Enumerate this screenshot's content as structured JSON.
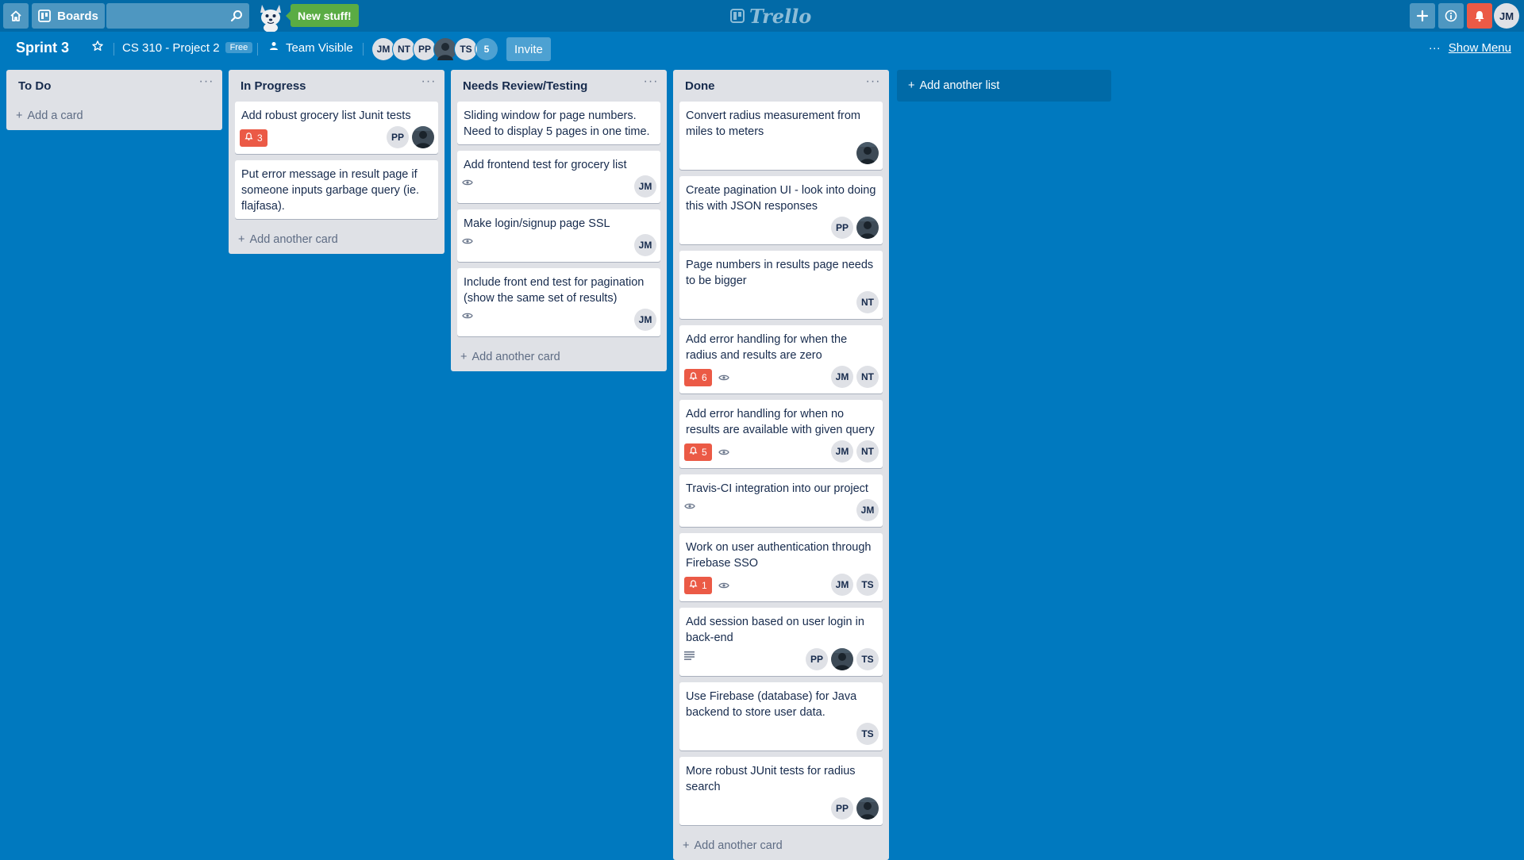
{
  "header": {
    "boards_label": "Boards",
    "search_value": "",
    "new_stuff_label": "New stuff!",
    "logo_text": "Trello",
    "user_initials": "JM"
  },
  "board": {
    "title": "Sprint 3",
    "team_name": "CS 310 - Project 2",
    "plan_badge": "Free",
    "visibility_label": "Team Visible",
    "members": [
      "JM",
      "NT",
      "PP",
      "",
      "TS"
    ],
    "extra_members_count": "5",
    "invite_label": "Invite",
    "show_menu_label": "Show Menu",
    "add_list_label": "Add another list"
  },
  "colors": {
    "background": "#0079bf",
    "topbar": "#026aa7",
    "due_badge": "#eb5a46",
    "new_stuff": "#5aac44",
    "list": "#dfe1e6"
  },
  "lists": [
    {
      "title": "To Do",
      "add_label": "Add a card",
      "cards": []
    },
    {
      "title": "In Progress",
      "add_label": "Add another card",
      "cards": [
        {
          "title": "Add robust grocery list Junit tests",
          "due": "3",
          "watch": false,
          "desc": false,
          "members": [
            "PP",
            "photo"
          ]
        },
        {
          "title": "Put error message in result page if someone inputs garbage query (ie. flajfasa).",
          "due": null,
          "watch": false,
          "desc": false,
          "members": []
        }
      ]
    },
    {
      "title": "Needs Review/Testing",
      "add_label": "Add another card",
      "cards": [
        {
          "title": "Sliding window for page numbers. Need to display 5 pages in one time.",
          "due": null,
          "watch": false,
          "desc": false,
          "members": []
        },
        {
          "title": "Add frontend test for grocery list",
          "due": null,
          "watch": true,
          "desc": false,
          "members": [
            "JM"
          ]
        },
        {
          "title": "Make login/signup page SSL",
          "due": null,
          "watch": true,
          "desc": false,
          "members": [
            "JM"
          ]
        },
        {
          "title": "Include front end test for pagination (show the same set of results)",
          "due": null,
          "watch": true,
          "desc": false,
          "members": [
            "JM"
          ]
        }
      ]
    },
    {
      "title": "Done",
      "add_label": "Add another card",
      "cards": [
        {
          "title": "Convert radius measurement from miles to meters",
          "due": null,
          "watch": false,
          "desc": false,
          "members": [
            "photo"
          ]
        },
        {
          "title": "Create pagination UI - look into doing this with JSON responses",
          "due": null,
          "watch": false,
          "desc": false,
          "members": [
            "PP",
            "photo"
          ]
        },
        {
          "title": "Page numbers in results page needs to be bigger",
          "due": null,
          "watch": false,
          "desc": false,
          "members": [
            "NT"
          ]
        },
        {
          "title": "Add error handling for when the radius and results are zero",
          "due": "6",
          "watch": true,
          "desc": false,
          "members": [
            "JM",
            "NT"
          ]
        },
        {
          "title": "Add error handling for when no results are available with given query",
          "due": "5",
          "watch": true,
          "desc": false,
          "members": [
            "JM",
            "NT"
          ]
        },
        {
          "title": "Travis-CI integration into our project",
          "due": null,
          "watch": true,
          "desc": false,
          "members": [
            "JM"
          ]
        },
        {
          "title": "Work on user authentication through Firebase SSO",
          "due": "1",
          "watch": true,
          "desc": false,
          "members": [
            "JM",
            "TS"
          ]
        },
        {
          "title": "Add session based on user login in back-end",
          "due": null,
          "watch": false,
          "desc": true,
          "members": [
            "PP",
            "photo",
            "TS"
          ]
        },
        {
          "title": "Use Firebase (database) for Java backend to store user data.",
          "due": null,
          "watch": false,
          "desc": false,
          "members": [
            "TS"
          ]
        },
        {
          "title": "More robust JUnit tests for radius search",
          "due": null,
          "watch": false,
          "desc": false,
          "members": [
            "PP",
            "photo"
          ]
        }
      ]
    }
  ]
}
